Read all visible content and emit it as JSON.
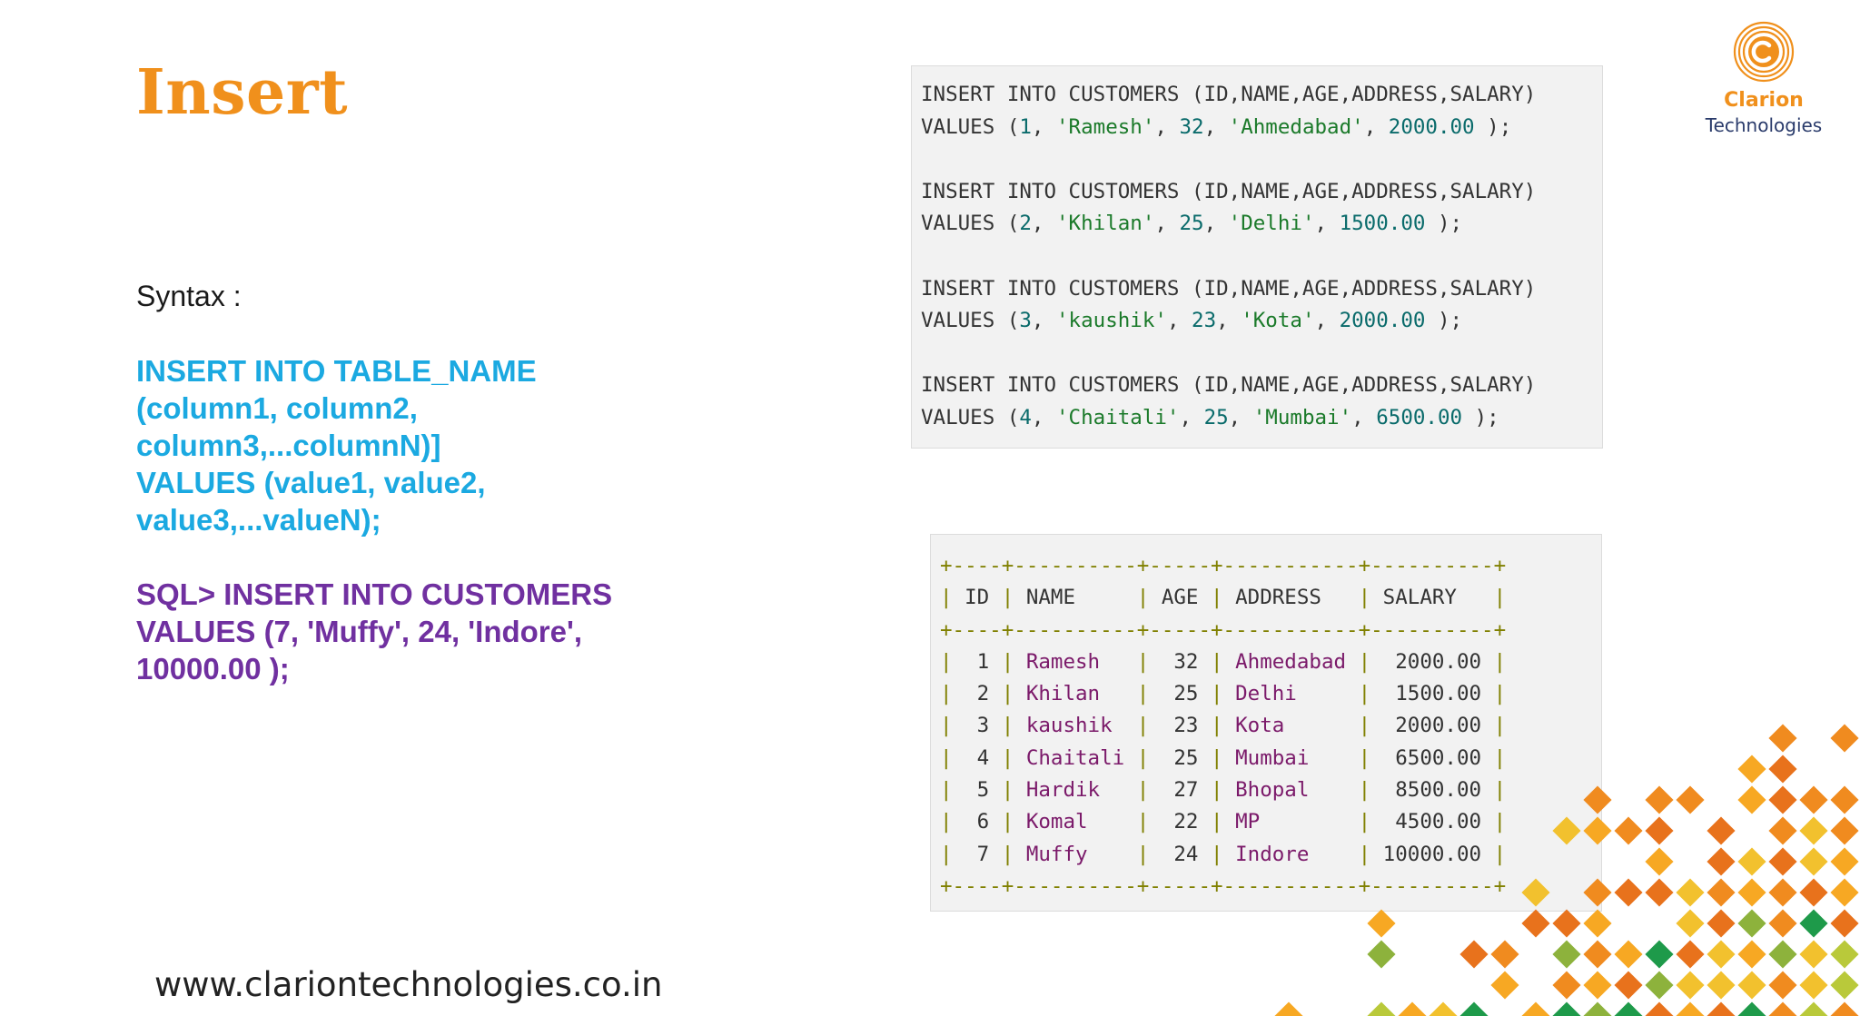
{
  "slide": {
    "title": "Insert",
    "syntax_label": "Syntax :",
    "syntax_lines": [
      "INSERT INTO TABLE_NAME",
      "(column1, column2,",
      "column3,...columnN)]",
      "VALUES (value1, value2,",
      "value3,...valueN);"
    ],
    "example_lines": [
      "SQL> INSERT INTO CUSTOMERS",
      "VALUES (7, 'Muffy', 24, 'Indore',",
      "10000.00 );"
    ],
    "website": "www.clariontechnologies.co.in"
  },
  "logo": {
    "name": "Clarion",
    "subtitle": "Technologies",
    "icon": "clarion-c-logo-icon"
  },
  "code_block": {
    "statements": [
      {
        "insert": "INSERT INTO CUSTOMERS (ID,NAME,AGE,ADDRESS,SALARY)",
        "id": "1",
        "name": "'Ramesh'",
        "age": "32",
        "address": "'Ahmedabad'",
        "salary": "2000.00"
      },
      {
        "insert": "INSERT INTO CUSTOMERS (ID,NAME,AGE,ADDRESS,SALARY)",
        "id": "2",
        "name": "'Khilan'",
        "age": "25",
        "address": "'Delhi'",
        "salary": "1500.00"
      },
      {
        "insert": "INSERT INTO CUSTOMERS (ID,NAME,AGE,ADDRESS,SALARY)",
        "id": "3",
        "name": "'kaushik'",
        "age": "23",
        "address": "'Kota'",
        "salary": "2000.00"
      },
      {
        "insert": "INSERT INTO CUSTOMERS (ID,NAME,AGE,ADDRESS,SALARY)",
        "id": "4",
        "name": "'Chaitali'",
        "age": "25",
        "address": "'Mumbai'",
        "salary": "6500.00"
      }
    ]
  },
  "result_table": {
    "border_line": "+----+----------+-----+-----------+----------+",
    "headers": [
      "ID",
      "NAME",
      "AGE",
      "ADDRESS",
      "SALARY"
    ],
    "rows": [
      [
        "1",
        "Ramesh",
        "32",
        "Ahmedabad",
        "2000.00"
      ],
      [
        "2",
        "Khilan",
        "25",
        "Delhi",
        "1500.00"
      ],
      [
        "3",
        "kaushik",
        "23",
        "Kota",
        "2000.00"
      ],
      [
        "4",
        "Chaitali",
        "25",
        "Mumbai",
        "6500.00"
      ],
      [
        "5",
        "Hardik",
        "27",
        "Bhopal",
        "8500.00"
      ],
      [
        "6",
        "Komal",
        "22",
        "MP",
        "4500.00"
      ],
      [
        "7",
        "Muffy",
        "24",
        "Indore",
        "10000.00"
      ]
    ]
  },
  "colors": {
    "title": "#f0901c",
    "syntax": "#1ba9e1",
    "example": "#7030a0",
    "code_background": "#f2f2f2",
    "table_border": "#808000",
    "table_text_accent": "#7b1a6a",
    "decoration": [
      "#f7a823",
      "#f08b1f",
      "#e8721c",
      "#f2c12e",
      "#b9c93a",
      "#8db23c",
      "#1e9a4a"
    ]
  }
}
